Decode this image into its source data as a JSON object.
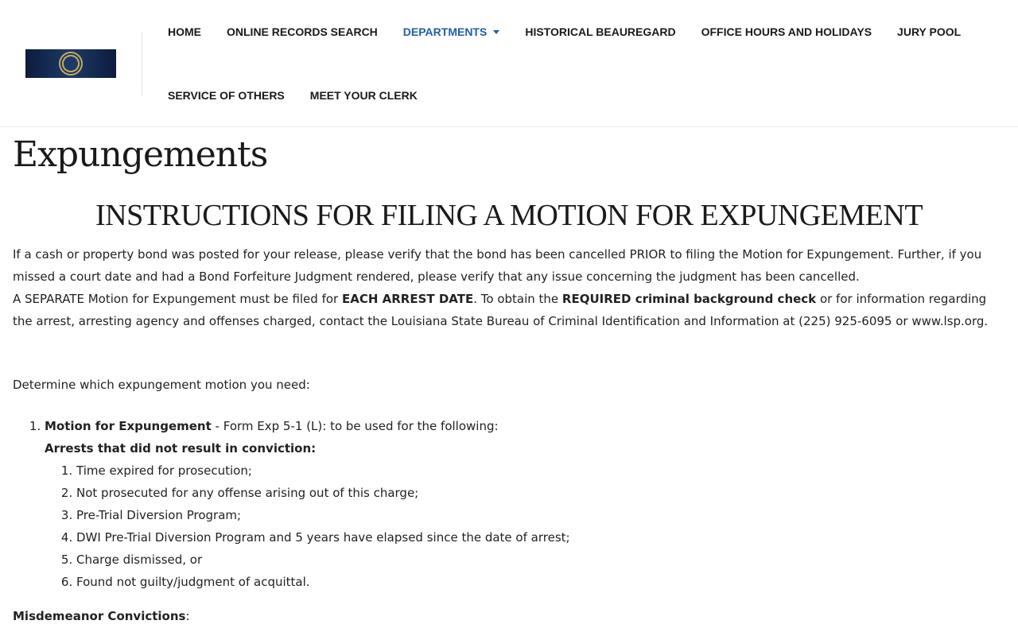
{
  "nav": {
    "items": [
      {
        "label": "HOME"
      },
      {
        "label": "ONLINE RECORDS SEARCH"
      },
      {
        "label": "DEPARTMENTS"
      },
      {
        "label": "HISTORICAL BEAUREGARD"
      },
      {
        "label": "OFFICE HOURS AND HOLIDAYS"
      },
      {
        "label": "JURY POOL"
      },
      {
        "label": "SERVICE OF OTHERS"
      },
      {
        "label": "MEET YOUR CLERK"
      }
    ]
  },
  "colors": {
    "accent": "#1f5fa8",
    "logo_bg": "#0c1c3d"
  },
  "page": {
    "title": "Expungements",
    "heading": "INSTRUCTIONS FOR FILING A MOTION FOR EXPUNGEMENT",
    "para1": "If a cash or property bond was posted for your release, please verify that the bond has been cancelled PRIOR to filing the Motion for Expungement. Further, if you missed a court date and had a Bond Forfeiture Judgment rendered, please verify that any issue concerning the judgment has been cancelled.",
    "para2": {
      "t1": "A SEPARATE Motion for Expungement must be filed for ",
      "b1": "EACH ARREST DATE",
      "t2": ". To obtain the ",
      "b2": "REQUIRED criminal background check",
      "t3": " or for information regarding the arrest, arresting agency and offenses charged, contact the Louisiana State Bureau of Criminal Identification and Information at (225) 925-6095 or www.lsp.org."
    },
    "determine": "Determine which expungement motion you need:",
    "list": {
      "item1_bold": "Motion for Expungement",
      "item1_rest": " - Form Exp 5-1 (L): to be used for the following:",
      "sub_heading": "Arrests that did not result in conviction:",
      "sub_items": [
        "Time expired for prosecution;",
        "Not prosecuted for any offense arising out of this charge;",
        "Pre-Trial Diversion Program;",
        "DWI Pre-Trial Diversion Program and 5 years have elapsed since the date of arrest;",
        "Charge dismissed, or",
        "Found not guilty/judgment of acquittal."
      ]
    },
    "misd_label": "Misdemeanor Convictions",
    "misd_colon": ":"
  }
}
